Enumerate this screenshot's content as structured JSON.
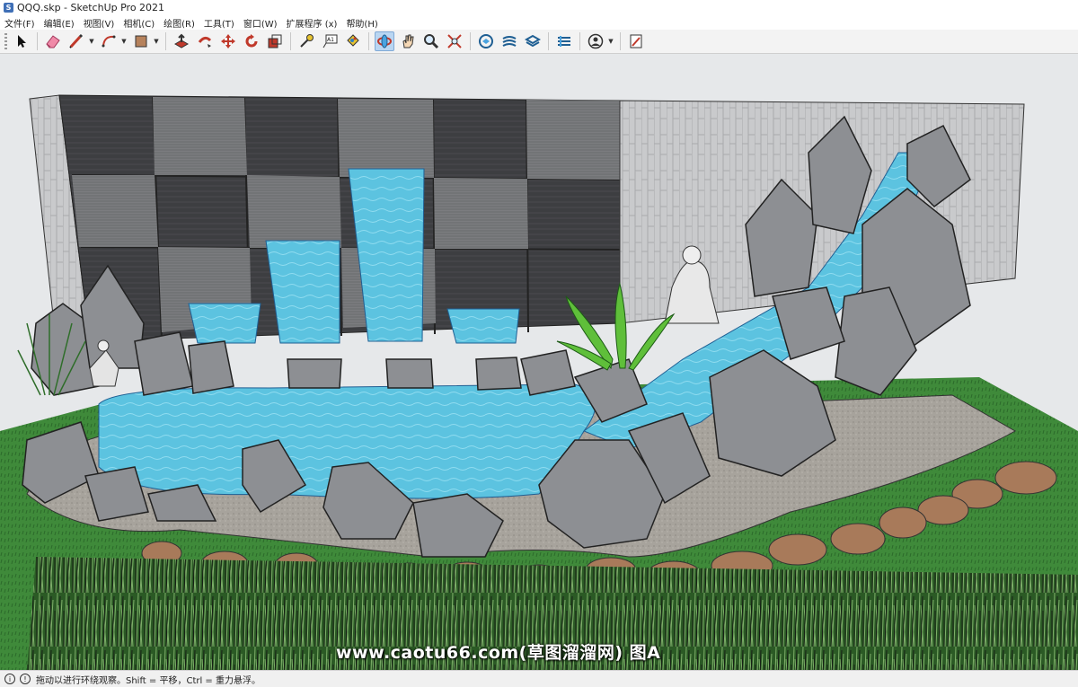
{
  "window": {
    "title": "QQQ.skp - SketchUp Pro 2021"
  },
  "menu": {
    "items": [
      {
        "label": "文件(F)"
      },
      {
        "label": "编辑(E)"
      },
      {
        "label": "视图(V)"
      },
      {
        "label": "相机(C)"
      },
      {
        "label": "绘图(R)"
      },
      {
        "label": "工具(T)"
      },
      {
        "label": "窗口(W)"
      },
      {
        "label": "扩展程序 (x)"
      },
      {
        "label": "帮助(H)"
      }
    ]
  },
  "toolbar": {
    "tools": [
      {
        "icon": "select-arrow-icon"
      },
      {
        "icon": "eraser-icon"
      },
      {
        "icon": "pencil-line-icon"
      },
      {
        "icon": "arc-icon"
      },
      {
        "icon": "rectangle-shape-icon"
      },
      {
        "icon": "push-pull-icon"
      },
      {
        "icon": "follow-me-icon"
      },
      {
        "icon": "move-icon"
      },
      {
        "icon": "rotate-icon"
      },
      {
        "icon": "scale-icon"
      },
      {
        "icon": "tape-measure-icon"
      },
      {
        "icon": "text-icon"
      },
      {
        "icon": "paint-bucket-icon"
      },
      {
        "icon": "orbit-icon",
        "active": true
      },
      {
        "icon": "pan-icon"
      },
      {
        "icon": "zoom-icon"
      },
      {
        "icon": "zoom-extents-icon"
      },
      {
        "icon": "3d-warehouse-icon"
      },
      {
        "icon": "extension-warehouse-icon"
      },
      {
        "icon": "layout-send-icon"
      },
      {
        "icon": "extension-manager-icon"
      },
      {
        "icon": "account-icon"
      },
      {
        "icon": "model-info-icon"
      }
    ],
    "text_tool_label": "A1"
  },
  "scene": {
    "description_label": "",
    "watermark": "www.caotu66.com(草图溜溜网) 图A",
    "colors": {
      "background": "#e6e8ea",
      "water": "#5cc3e0",
      "grass": "#3f8a3a",
      "rock": "#8d8f93",
      "wall_dark": "#3d3e41",
      "wall_light": "#c9cacc",
      "gravel": "#a7a39c",
      "stepping_stone": "#a87a5a"
    }
  },
  "status": {
    "text": "拖动以进行环绕观察。Shift = 平移，Ctrl = 重力悬浮。"
  }
}
